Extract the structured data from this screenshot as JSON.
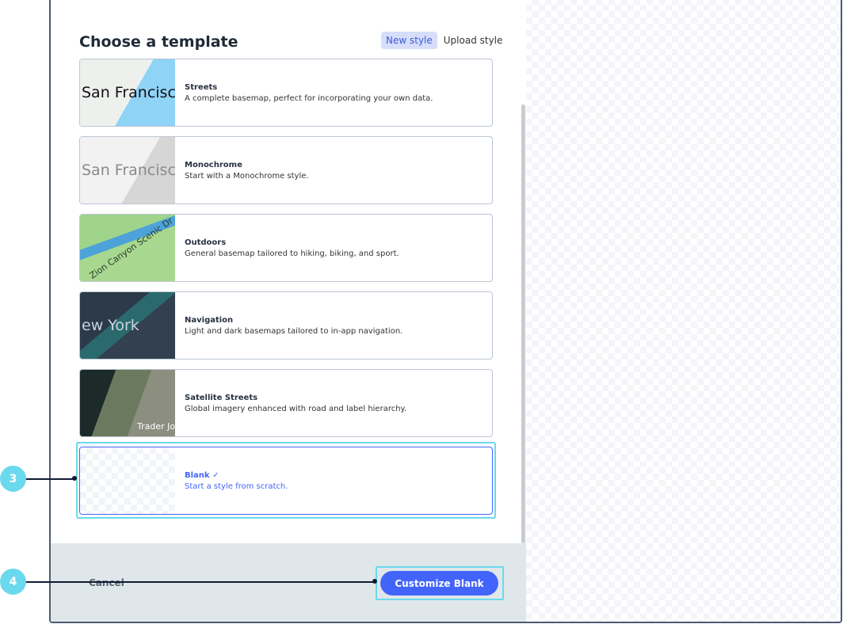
{
  "header": {
    "title": "Choose a template",
    "tabs": [
      {
        "label": "New style",
        "active": true
      },
      {
        "label": "Upload style",
        "active": false
      }
    ]
  },
  "templates": [
    {
      "name": "Streets",
      "description": "A complete basemap, perfect for incorporating your own data.",
      "thumb_label": "San Francisco"
    },
    {
      "name": "Monochrome",
      "description": "Start with a Monochrome style.",
      "thumb_label": "San Francisco"
    },
    {
      "name": "Outdoors",
      "description": "General basemap tailored to hiking, biking, and sport.",
      "thumb_label": "Zion Canyon Scenic Dr"
    },
    {
      "name": "Navigation",
      "description": "Light and dark basemaps tailored to in-app navigation.",
      "thumb_label": "ew York"
    },
    {
      "name": "Satellite Streets",
      "description": "Global imagery enhanced with road and label hierarchy.",
      "thumb_label": "Trader Jo"
    },
    {
      "name": "Blank",
      "description": "Start a style from scratch.",
      "selected": true,
      "icon": "check-icon"
    }
  ],
  "footer": {
    "cancel_label": "Cancel",
    "customize_label": "Customize Blank"
  },
  "annotations": [
    "3",
    "4"
  ],
  "colors": {
    "accent": "#4264fb",
    "highlight": "#6ad9ee"
  }
}
